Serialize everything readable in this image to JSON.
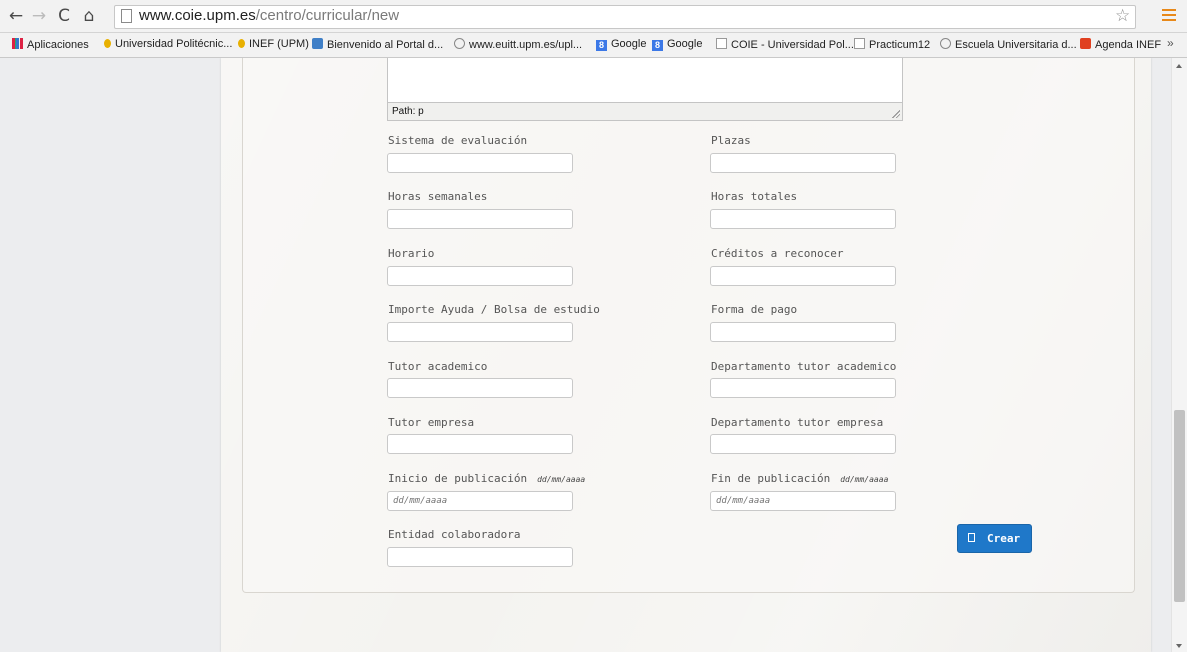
{
  "browser": {
    "url_domain": "www.coie.upm.es",
    "url_path": "/centro/curricular/new",
    "bookmarks": [
      {
        "label": "Aplicaciones",
        "icon": "apps-icon"
      },
      {
        "label": "Universidad Politécnic...",
        "icon": "upm-icon"
      },
      {
        "label": "INEF (UPM)",
        "icon": "upm-icon"
      },
      {
        "label": "Bienvenido al Portal d...",
        "icon": "user-icon"
      },
      {
        "label": "www.euitt.upm.es/upl...",
        "icon": "globe-icon"
      },
      {
        "label": "Google",
        "icon": "google-icon"
      },
      {
        "label": "Google",
        "icon": "google-icon"
      },
      {
        "label": "COIE - Universidad Pol...",
        "icon": "page-icon"
      },
      {
        "label": "Practicum12",
        "icon": "page-icon"
      },
      {
        "label": "Escuela Universitaria d...",
        "icon": "globe-icon"
      },
      {
        "label": "Agenda INEF",
        "icon": "agenda-icon"
      }
    ],
    "more_label": "»"
  },
  "editor": {
    "path_label": "Path: p"
  },
  "form": {
    "sistema_label": "Sistema de evaluación",
    "plazas_label": "Plazas",
    "horas_semanales_label": "Horas semanales",
    "horas_totales_label": "Horas totales",
    "horario_label": "Horario",
    "creditos_label": "Créditos a reconocer",
    "importe_label": "Importe Ayuda / Bolsa de estudio",
    "forma_pago_label": "Forma de pago",
    "tutor_academico_label": "Tutor academico",
    "depto_tutor_academico_label": "Departamento tutor academico",
    "tutor_empresa_label": "Tutor empresa",
    "depto_tutor_empresa_label": "Departamento tutor empresa",
    "inicio_label": "Inicio de publicación",
    "inicio_hint": "dd/mm/aaaa",
    "inicio_placeholder": "dd/mm/aaaa",
    "fin_label": "Fin de publicación",
    "fin_hint": "dd/mm/aaaa",
    "fin_placeholder": "dd/mm/aaaa",
    "entidad_label": "Entidad colaboradora",
    "submit_label": "Crear"
  },
  "colors": {
    "primary_button": "#1f78c9",
    "menu_accent": "#e8891a"
  }
}
